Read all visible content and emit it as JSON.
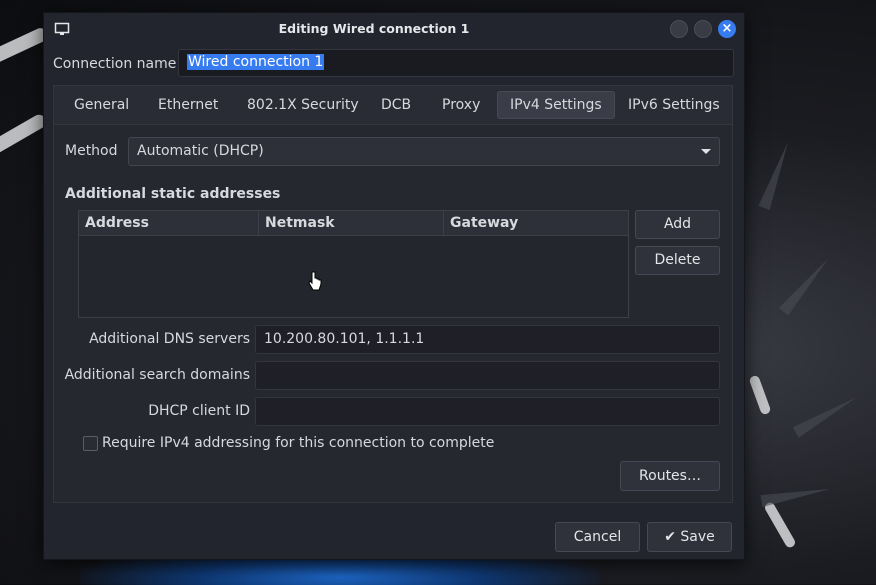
{
  "window": {
    "title": "Editing Wired connection 1"
  },
  "connection": {
    "label": "Connection name",
    "value": "Wired connection 1"
  },
  "tabs": [
    {
      "label": "General"
    },
    {
      "label": "Ethernet"
    },
    {
      "label": "802.1X Security"
    },
    {
      "label": "DCB"
    },
    {
      "label": "Proxy"
    },
    {
      "label": "IPv4 Settings",
      "active": true
    },
    {
      "label": "IPv6 Settings"
    }
  ],
  "ipv4": {
    "method_label": "Method",
    "method_value": "Automatic (DHCP)",
    "static_title": "Additional static addresses",
    "columns": [
      "Address",
      "Netmask",
      "Gateway"
    ],
    "add_label": "Add",
    "delete_label": "Delete",
    "dns_label": "Additional DNS servers",
    "dns_value": "10.200.80.101, 1.1.1.1",
    "search_label": "Additional search domains",
    "search_value": "",
    "dhcp_label": "DHCP client ID",
    "dhcp_value": "",
    "require_label": "Require IPv4 addressing for this connection to complete",
    "require_checked": false,
    "routes_label": "Routes…"
  },
  "footer": {
    "cancel_label": "Cancel",
    "save_label": "Save"
  },
  "colors": {
    "accent": "#367bf0",
    "dialog_bg": "#23252e"
  }
}
